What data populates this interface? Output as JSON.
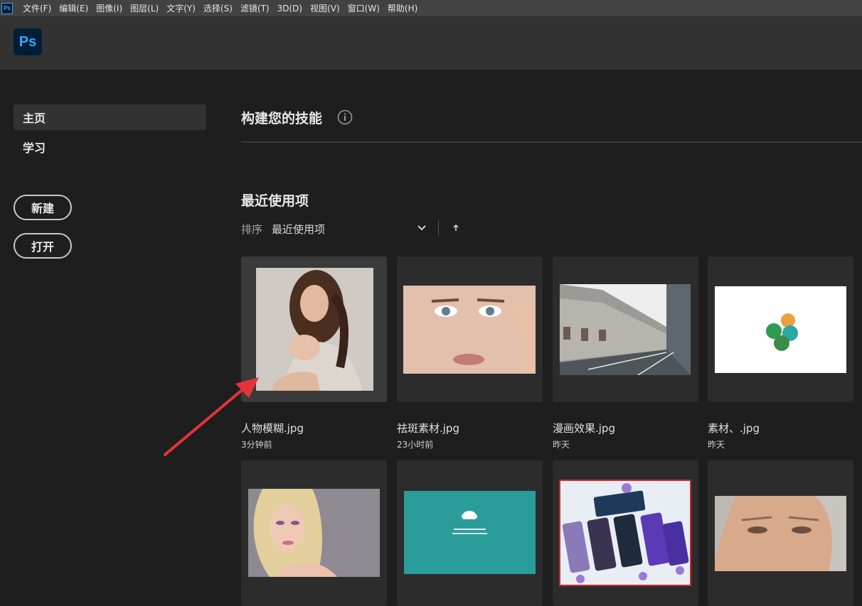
{
  "menubar": {
    "app_icon": "Ps",
    "items": [
      "文件(F)",
      "编辑(E)",
      "图像(I)",
      "图层(L)",
      "文字(Y)",
      "选择(S)",
      "滤镜(T)",
      "3D(D)",
      "视图(V)",
      "窗口(W)",
      "帮助(H)"
    ]
  },
  "header": {
    "logo": "Ps"
  },
  "sidebar": {
    "nav": [
      {
        "label": "主页",
        "active": true
      },
      {
        "label": "学习",
        "active": false
      }
    ],
    "new_label": "新建",
    "open_label": "打开"
  },
  "main": {
    "skills_title": "构建您的技能",
    "recent_title": "最近使用项",
    "sort_label": "排序",
    "sort_value": "最近使用项",
    "files": [
      {
        "name": "人物模糊.jpg",
        "time": "3分钟前"
      },
      {
        "name": "祛斑素材.jpg",
        "time": "23小时前"
      },
      {
        "name": "漫画效果.jpg",
        "time": "昨天"
      },
      {
        "name": "素材、.jpg",
        "time": "昨天"
      }
    ]
  },
  "colors": {
    "accent": "#31a8ff",
    "logo_bg": "#001e36",
    "annotation_arrow": "#e8323a",
    "teal_thumb": "#2a9d9a"
  }
}
